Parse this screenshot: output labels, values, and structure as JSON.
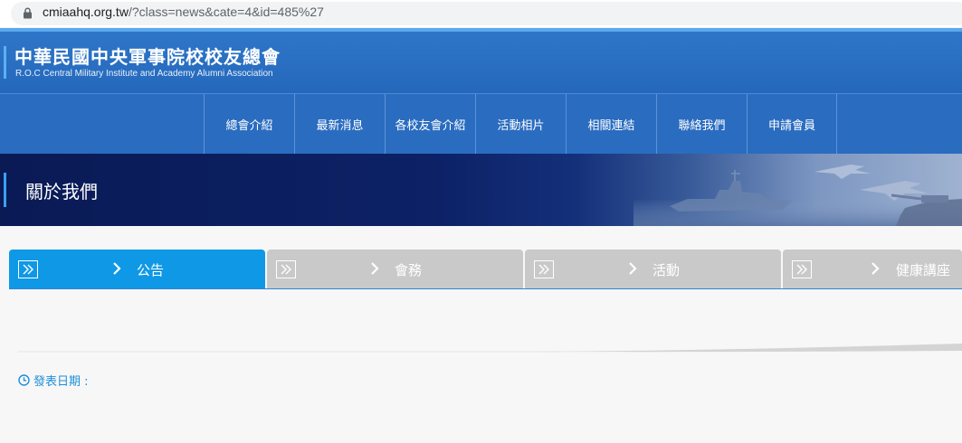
{
  "browser": {
    "url_host": "cmiaahq.org.tw",
    "url_path": "/?class=news&cate=4&id=485%27"
  },
  "header": {
    "title": "中華民國中央軍事院校校友總會",
    "subtitle": "R.O.C Central Military Institute and Academy Alumni Association"
  },
  "nav": {
    "items": [
      {
        "label": "總會介紹"
      },
      {
        "label": "最新消息"
      },
      {
        "label": "各校友會介紹"
      },
      {
        "label": "活動相片"
      },
      {
        "label": "相關連結"
      },
      {
        "label": "聯絡我們"
      },
      {
        "label": "申請會員"
      }
    ]
  },
  "banner": {
    "title": "關於我們"
  },
  "tabs": [
    {
      "label": "公告",
      "active": true
    },
    {
      "label": "會務",
      "active": false
    },
    {
      "label": "活動",
      "active": false
    },
    {
      "label": "健康講座",
      "active": false
    }
  ],
  "article": {
    "date_label": "發表日期 :"
  },
  "colors": {
    "header_blue": "#2a6cc0",
    "active_tab": "#0f98e6",
    "inactive_tab": "#c9c9c9",
    "date_text": "#1e8fd9"
  }
}
